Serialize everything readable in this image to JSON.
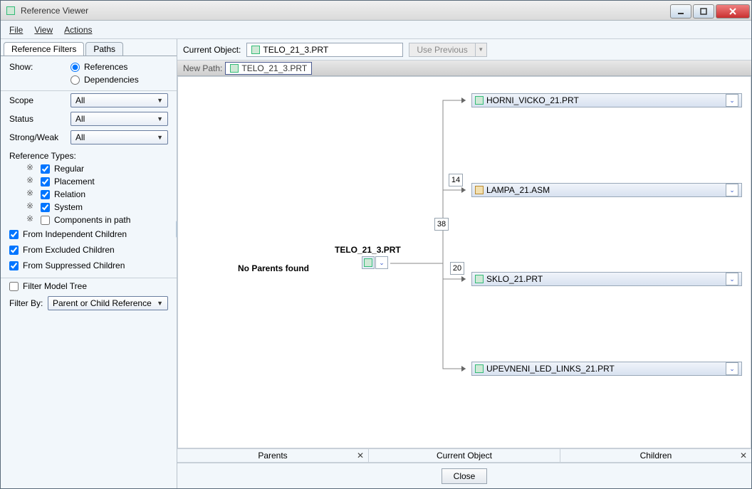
{
  "window": {
    "title": "Reference Viewer"
  },
  "menu": {
    "file": "File",
    "view": "View",
    "actions": "Actions"
  },
  "tabs": {
    "filters": "Reference Filters",
    "paths": "Paths"
  },
  "show": {
    "label": "Show:",
    "references": "References",
    "dependencies": "Dependencies"
  },
  "filter": {
    "scope_label": "Scope",
    "scope_value": "All",
    "status_label": "Status",
    "status_value": "All",
    "sw_label": "Strong/Weak",
    "sw_value": "All"
  },
  "ref_types": {
    "title": "Reference Types:",
    "regular": "Regular",
    "placement": "Placement",
    "relation": "Relation",
    "system": "System",
    "components": "Components in path"
  },
  "from": {
    "independent": "From Independent Children",
    "excluded": "From Excluded Children",
    "suppressed": "From Suppressed Children"
  },
  "tree_filter": "Filter Model Tree",
  "filter_by": {
    "label": "Filter By:",
    "value": "Parent or Child Reference"
  },
  "topbar": {
    "label": "Current Object:",
    "value": "TELO_21_3.PRT",
    "use_previous": "Use Previous"
  },
  "newpath": {
    "label": "New Path:",
    "chip": "TELO_21_3.PRT"
  },
  "canvas": {
    "no_parents": "No Parents found",
    "center": "TELO_21_3.PRT",
    "children": [
      {
        "label": "HORNI_VICKO_21.PRT",
        "count": "14",
        "kind": "prt"
      },
      {
        "label": "LAMPA_21.ASM",
        "count": "38",
        "kind": "asm"
      },
      {
        "label": "SKLO_21.PRT",
        "count": "20",
        "kind": "prt"
      },
      {
        "label": "UPEVNENI_LED_LINKS_21.PRT",
        "count": "",
        "kind": "prt"
      }
    ]
  },
  "columns": {
    "parents": "Parents",
    "current": "Current Object",
    "children": "Children"
  },
  "footer": {
    "close": "Close"
  }
}
